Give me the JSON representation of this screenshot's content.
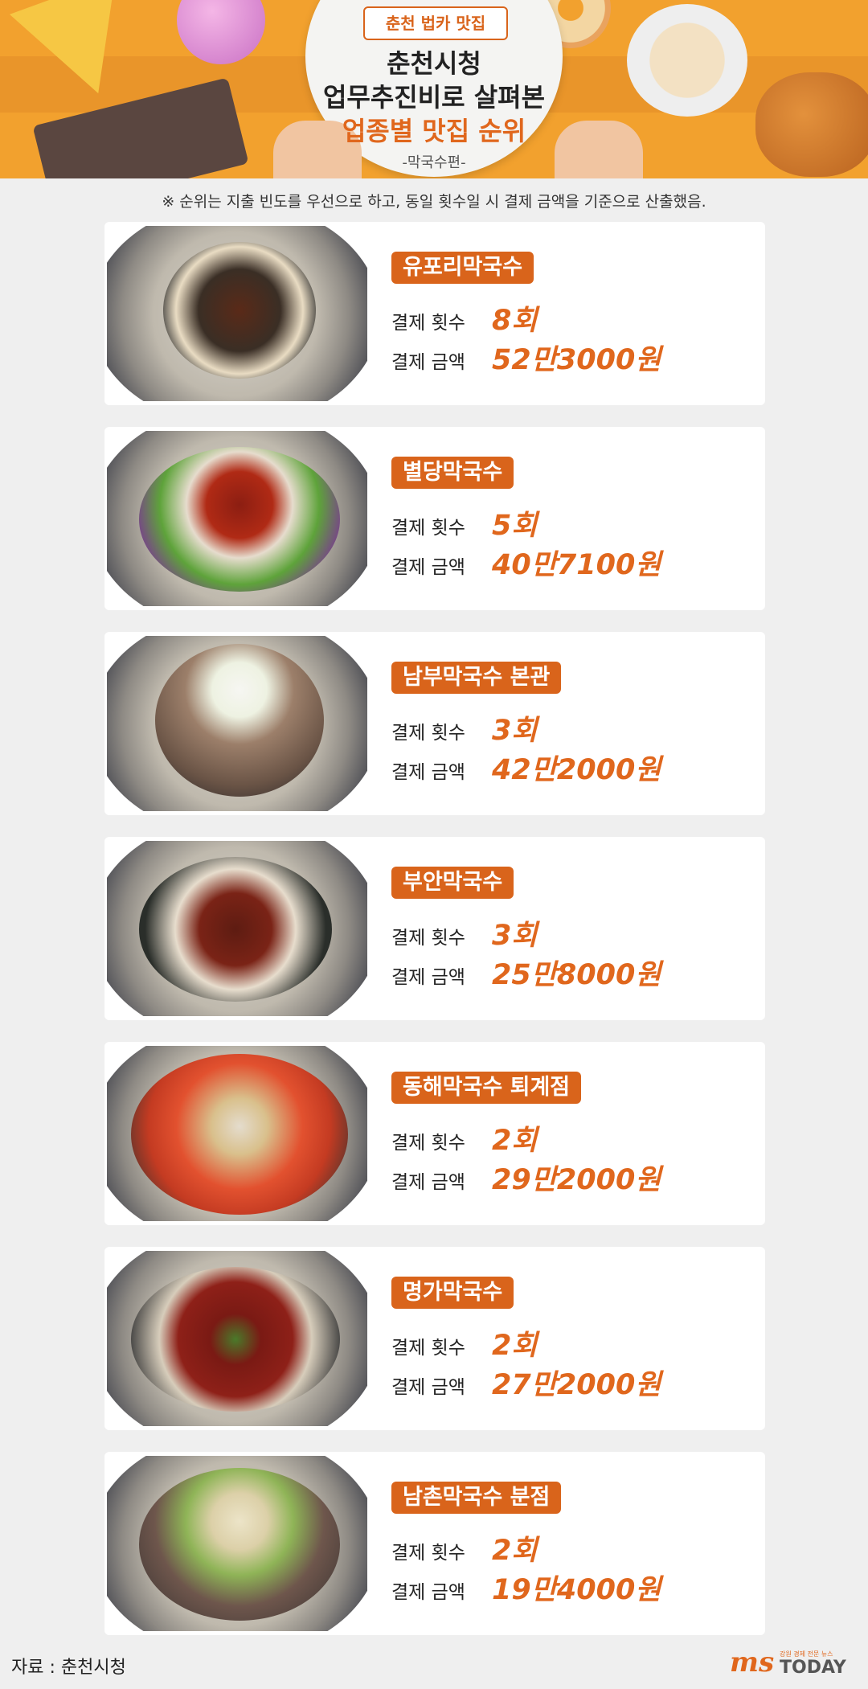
{
  "header": {
    "badge": "춘천 법카 맛집",
    "title_line1": "춘천시청",
    "title_line2": "업무추진비로 살펴본",
    "title_line3": "업종별 맛집 순위",
    "subtitle": "-막국수편-"
  },
  "note": "※ 순위는 지출 빈도를 우선으로 하고, 동일 횟수일 시 결제 금액을 기준으로 산출했음.",
  "labels": {
    "count": "결제 횟수",
    "amount": "결제 금액"
  },
  "restaurants": [
    {
      "name": "유포리막국수",
      "count": "8회",
      "amount": "52만3000원"
    },
    {
      "name": "별당막국수",
      "count": "5회",
      "amount": "40만7100원"
    },
    {
      "name": "남부막국수 본관",
      "count": "3회",
      "amount": "42만2000원"
    },
    {
      "name": "부안막국수",
      "count": "3회",
      "amount": "25만8000원"
    },
    {
      "name": "동해막국수 퇴계점",
      "count": "2회",
      "amount": "29만2000원"
    },
    {
      "name": "명가막국수",
      "count": "2회",
      "amount": "27만2000원"
    },
    {
      "name": "남촌막국수 분점",
      "count": "2회",
      "amount": "19만4000원"
    }
  ],
  "footer": {
    "source": "자료 : 춘천시청",
    "logo_ms": "ms",
    "logo_tag": "강원 경제 전문 뉴스",
    "logo_today": "TODAY"
  },
  "colors": {
    "header_bg": "#f2a12e",
    "accent": "#e0671d",
    "tag_bg": "#d9641b"
  }
}
